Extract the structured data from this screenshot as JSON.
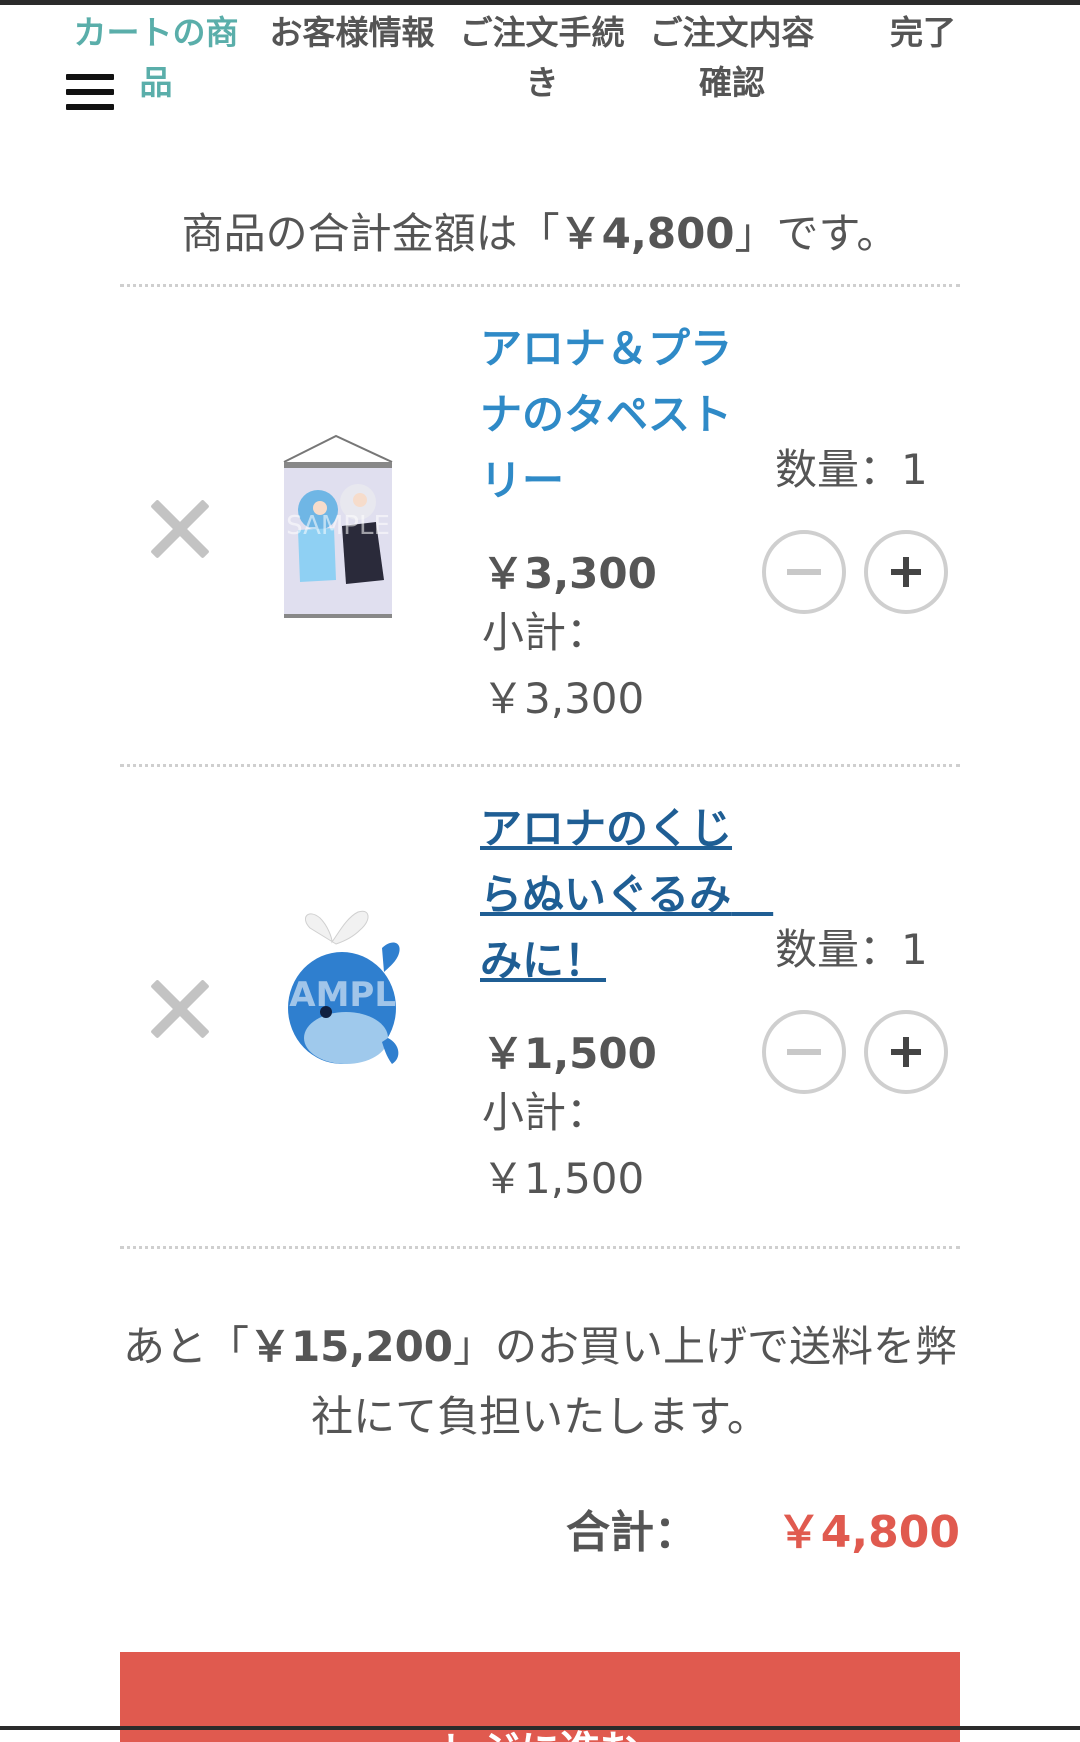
{
  "steps": [
    {
      "label": "カートの商品",
      "active": true
    },
    {
      "label": "お客様情報",
      "active": false
    },
    {
      "label": "ご注文手続き",
      "active": false
    },
    {
      "label": "ご注文内容確認",
      "active": false
    },
    {
      "label": "完了",
      "active": false
    }
  ],
  "summary": {
    "prefix": "商品の合計金額は「",
    "amount": "￥4,800",
    "suffix": "」です。"
  },
  "items": [
    {
      "name": "アロナ＆プラナのタペストリー",
      "price": "￥3,300",
      "subtotal_label": "小計：",
      "subtotal": "￥3,300",
      "qty_label": "数量：1",
      "image_watermark": "SAMPLE"
    },
    {
      "name": "アロナのくじらぬいぐるみ　みに！",
      "price": "￥1,500",
      "subtotal_label": "小計：",
      "subtotal": "￥1,500",
      "qty_label": "数量：1",
      "image_watermark": "SAMPLE"
    }
  ],
  "shipping": {
    "prefix": "あと「",
    "amount": "￥15,200",
    "suffix": "」のお買い上げで送料を弊社にて負担いたします。"
  },
  "total": {
    "label": "合計：",
    "value": "￥4,800"
  },
  "checkout_label": "レジに進む",
  "colors": {
    "accent": "#5aaeaa",
    "link": "#2f8ac7",
    "price_red": "#e05a4f",
    "button_red": "#e05a4f"
  },
  "icons": {
    "menu": "hamburger-icon",
    "remove": "close-icon",
    "decrease": "minus-icon",
    "increase": "plus-icon"
  }
}
